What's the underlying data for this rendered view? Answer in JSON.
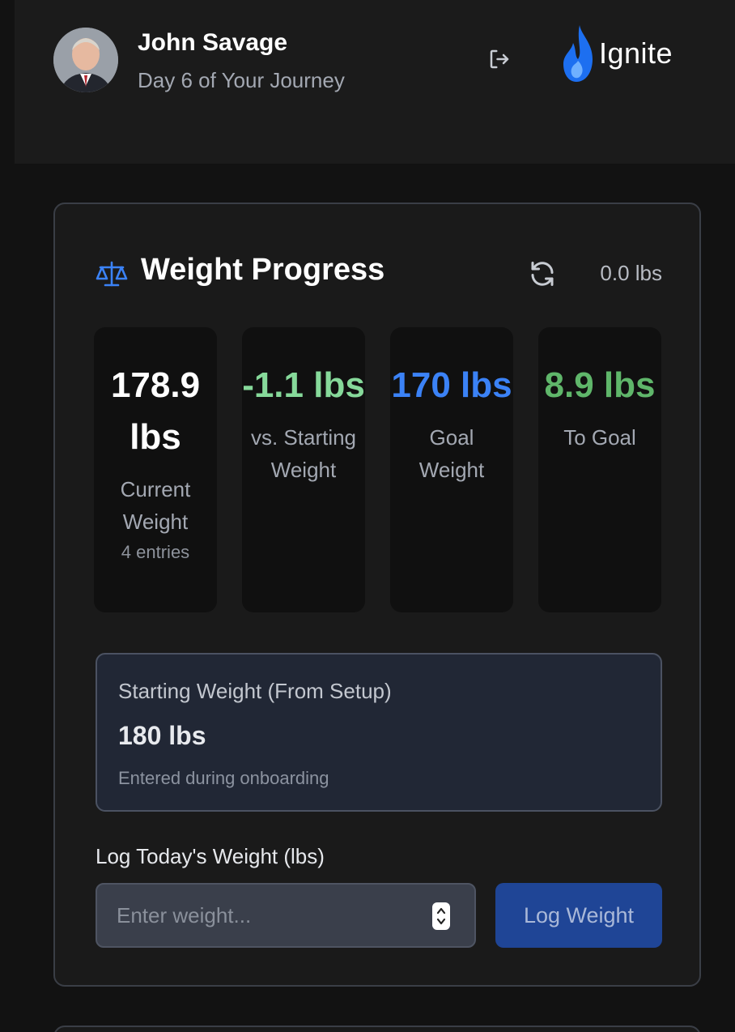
{
  "header": {
    "user_name": "John Savage",
    "subtitle": "Day 6 of Your Journey",
    "brand_name": "Ignite",
    "avatar_icon": "user-photo-avatar",
    "logout_icon": "logout-icon",
    "brand_icon": "flame-logo-icon"
  },
  "weight_card": {
    "title": "Weight Progress",
    "title_icon": "scale-icon",
    "refresh_icon": "refresh-icon",
    "change_badge": "0.0 lbs",
    "stats": [
      {
        "value": "178.9 lbs",
        "label": "Current Weight",
        "note": "4 entries",
        "color": "#ffffff"
      },
      {
        "value": "-1.1 lbs",
        "label": "vs. Starting Weight",
        "color": "#86d99a"
      },
      {
        "value": "170 lbs",
        "label": "Goal Weight",
        "color": "#3b82f6"
      },
      {
        "value": "8.9 lbs",
        "label": "To Goal",
        "color": "#5fb66a"
      }
    ],
    "starting": {
      "label": "Starting Weight (From Setup)",
      "value": "180 lbs",
      "note": "Entered during onboarding"
    },
    "log": {
      "label": "Log Today's Weight (lbs)",
      "placeholder": "Enter weight...",
      "value": "",
      "button_label": "Log Weight"
    }
  },
  "colors": {
    "accent": "#3b82f6",
    "positive": "#86d99a",
    "button": "#1f4596"
  }
}
